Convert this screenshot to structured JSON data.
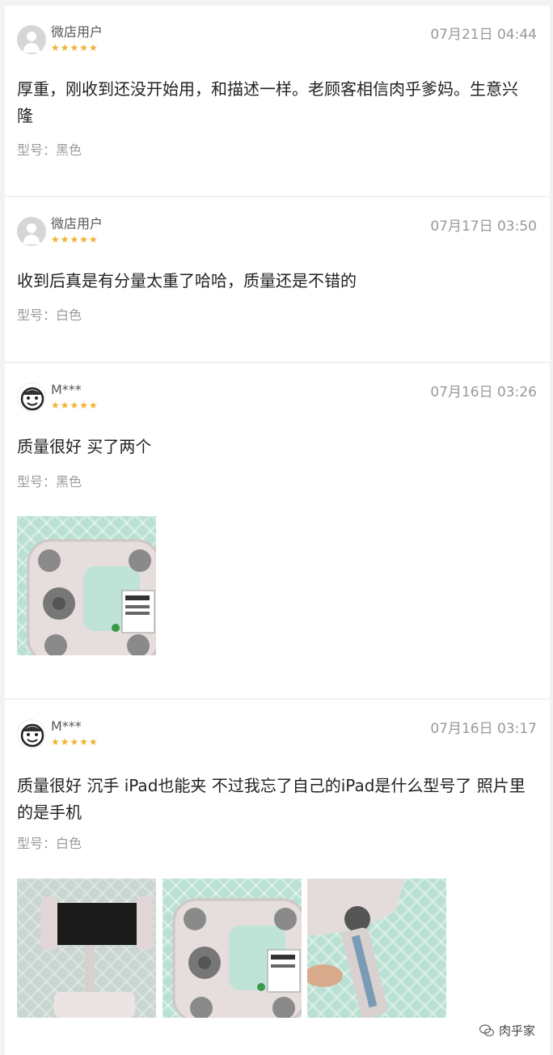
{
  "reviews": [
    {
      "user": "微店用户",
      "stars": "★★★★★",
      "date": "07月21日 04:44",
      "text": "厚重，刚收到还没开始用，和描述一样。老顾客相信肉乎爹妈。生意兴隆",
      "model": "型号：黑色"
    },
    {
      "user": "微店用户",
      "stars": "★★★★★",
      "date": "07月17日 03:50",
      "text": "收到后真是有分量太重了哈哈，质量还是不错的",
      "model": "型号：白色"
    },
    {
      "user": "M***",
      "stars": "★★★★★",
      "date": "07月16日 03:26",
      "text": "质量很好 买了两个",
      "model": "型号：黑色"
    },
    {
      "user": "M***",
      "stars": "★★★★★",
      "date": "07月16日 03:17",
      "text": "质量很好 沉手 iPad也能夹 不过我忘了自己的iPad是什么型号了 照片里的是手机",
      "model": "型号：白色"
    }
  ],
  "watermark": "肉乎家",
  "colors": {
    "star": "#f2b130",
    "date": "#999999",
    "background": "#f2f2f2"
  }
}
